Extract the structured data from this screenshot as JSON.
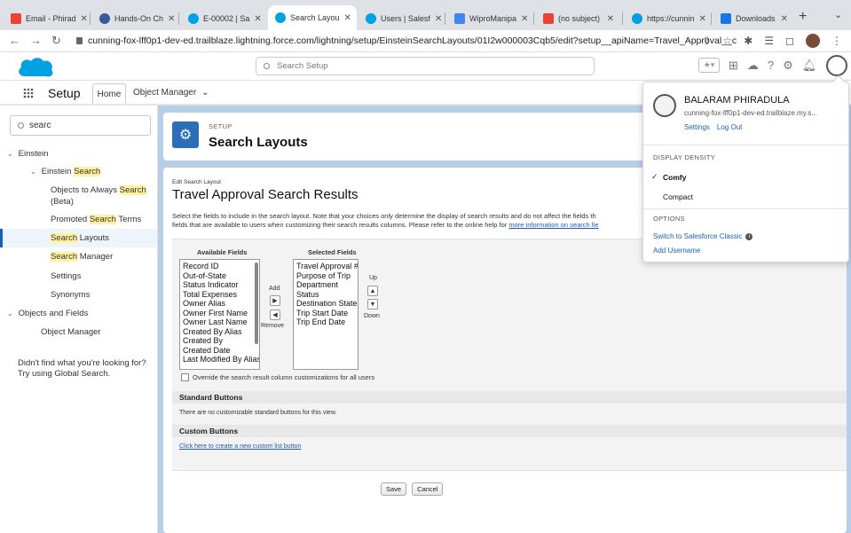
{
  "browser": {
    "tabs": [
      {
        "label": "Email - Phirad",
        "icon": "gmail-icon"
      },
      {
        "label": "Hands-On Ch",
        "icon": "people-icon"
      },
      {
        "label": "E-00002 | Sa",
        "icon": "salesforce-icon"
      },
      {
        "label": "Search Layou",
        "icon": "salesforce-icon"
      },
      {
        "label": "Users | Salesf",
        "icon": "salesforce-icon"
      },
      {
        "label": "WiproManipa",
        "icon": "docs-icon"
      },
      {
        "label": "(no subject)",
        "icon": "gmail-icon"
      },
      {
        "label": "https://cunnin",
        "icon": "salesforce-icon"
      },
      {
        "label": "Downloads",
        "icon": "download-icon"
      }
    ],
    "url": "cunning-fox-lff0p1-dev-ed.trailblaze.lightning.force.com/lightning/setup/EinsteinSearchLayouts/01I2w000003Cqb5/edit?setup__apiName=Travel_Approval__c"
  },
  "header": {
    "search_placeholder": "Search Setup"
  },
  "appnav": {
    "app_name": "Setup",
    "home_tab": "Home",
    "object_manager_tab": "Object Manager"
  },
  "sidebar": {
    "quick_find_value": "searc",
    "einstein": "Einstein",
    "einstein_search_prefix": "Einstein ",
    "einstein_search_hl": "Search",
    "objects_always_prefix": "Objects to Always ",
    "objects_always_hl": "Search",
    "objects_always_suffix": "(Beta)",
    "promoted_prefix": "Promoted ",
    "promoted_hl": "Search",
    "promoted_suffix": " Terms",
    "search_layouts_hl": "Search",
    "search_layouts_suffix": " Layouts",
    "search_manager_hl": "Search",
    "search_manager_suffix": " Manager",
    "settings": "Settings",
    "synonyms": "Synonyms",
    "objects_fields": "Objects and Fields",
    "object_manager": "Object Manager",
    "help_line1": "Didn't find what you're looking for?",
    "help_line2": "Try using Global Search."
  },
  "setup_card": {
    "kicker": "SETUP",
    "title": "Search Layouts"
  },
  "edit": {
    "kicker": "Edit Search Layout",
    "title": "Travel Approval Search Results",
    "desc_line1": "Select the fields to include in the search layout. Note that your choices only determine the display of search results and do not affect the fields th",
    "desc_line2": "fields that are available to users when customizing their search results columns. Please refer to the online help for ",
    "desc_link": "more information on search fie",
    "available_label": "Available Fields",
    "selected_label": "Selected Fields",
    "available_fields": [
      "Record ID",
      "Out-of-State",
      "Status Indicator",
      "Total Expenses",
      "Owner Alias",
      "Owner First Name",
      "Owner Last Name",
      "Created By Alias",
      "Created By",
      "Created Date",
      "Last Modified By Alias"
    ],
    "selected_fields": [
      "Travel Approval #",
      "Purpose of Trip",
      "Department",
      "Status",
      "Destination State",
      "Trip Start Date",
      "Trip End Date"
    ],
    "add_label": "Add",
    "remove_label": "Remove",
    "up_label": "Up",
    "down_label": "Down",
    "override_label": "Override the search result column customizations for all users",
    "standard_buttons_title": "Standard Buttons",
    "standard_buttons_text": "There are no customizable standard buttons for this view.",
    "custom_buttons_title": "Custom Buttons",
    "custom_buttons_link": "Click here to create a new custom list button",
    "save_label": "Save",
    "cancel_label": "Cancel"
  },
  "profile": {
    "name": "BALARAM PHIRADULA",
    "domain": "cunning-fox-lff0p1-dev-ed.trailblaze.my.s...",
    "settings_link": "Settings",
    "logout_link": "Log Out",
    "density_heading": "DISPLAY DENSITY",
    "comfy": "Comfy",
    "compact": "Compact",
    "options_heading": "OPTIONS",
    "switch_classic": "Switch to Salesforce Classic",
    "add_username": "Add Username"
  }
}
